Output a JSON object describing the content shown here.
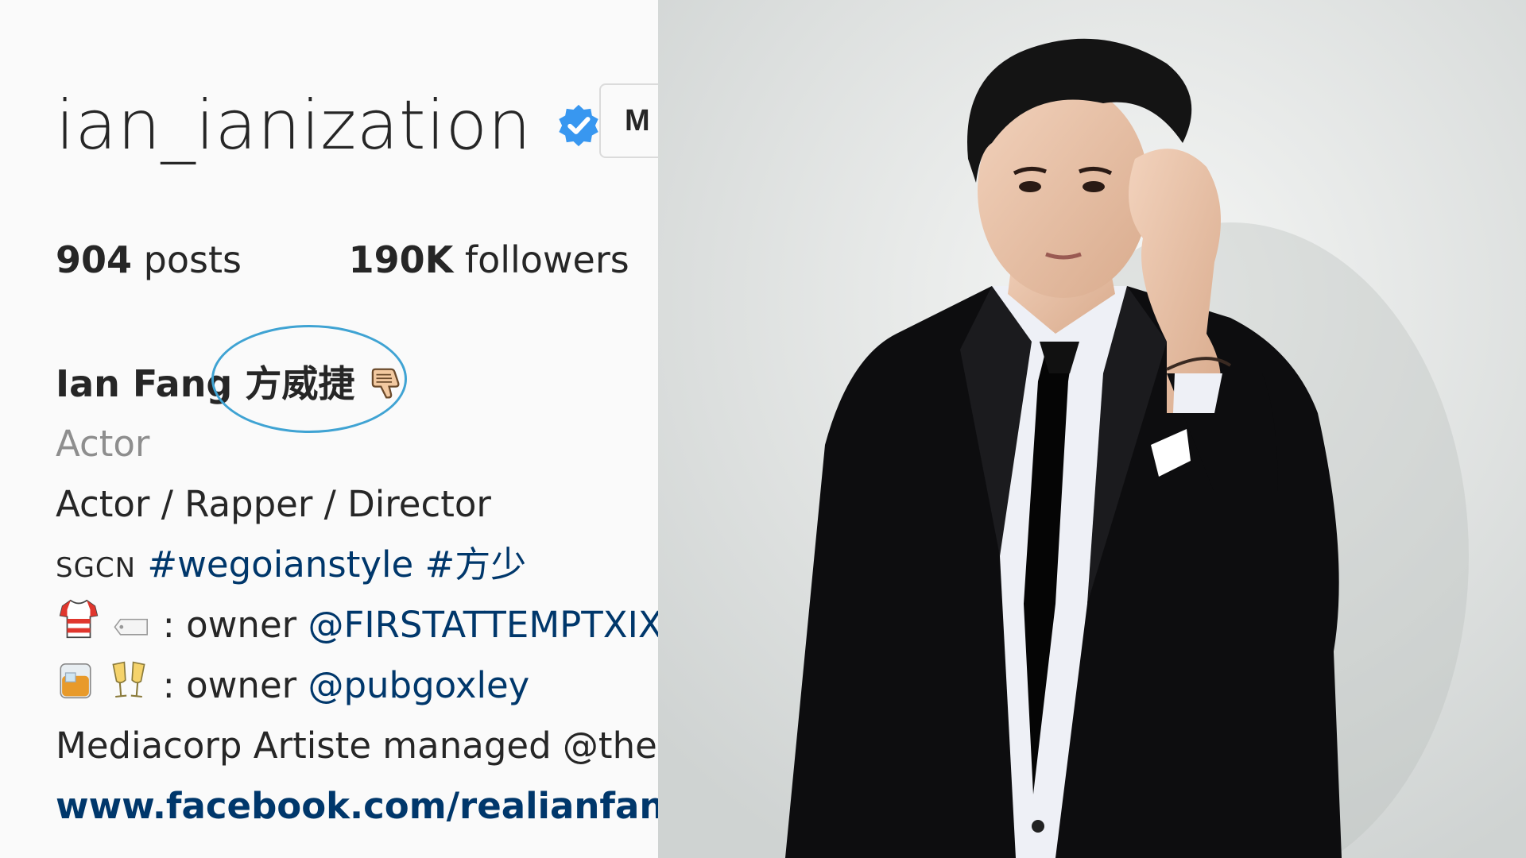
{
  "profile": {
    "username": "ian_ianization",
    "message_button": "M",
    "stats": {
      "posts_count": "904",
      "posts_label": "posts",
      "followers_count": "190K",
      "followers_label": "followers"
    },
    "full_name": "Ian Fang",
    "full_name_cn": "方威捷",
    "full_name_emoji": "👎",
    "category": "Actor",
    "bio": {
      "line1": "Actor / Rapper / Director",
      "line2_prefix": "SGCN",
      "line2_tags": "#wegoianstyle #方少",
      "line3_text": ": owner",
      "line3_mention": "@FIRSTATTEMPTXIX",
      "line4_text": ": owner",
      "line4_mention": "@pubgoxley",
      "line5": "Mediacorp Artiste managed @the",
      "link": "www.facebook.com/realianfang"
    }
  },
  "colors": {
    "verified_blue": "#3897f0",
    "link_blue": "#00376b",
    "circle_annotation": "#3fa3d3"
  },
  "icons": [
    "verified-badge-icon",
    "thumbs-down-emoji",
    "shirt-emoji",
    "tag-emoji",
    "whisky-glass-emoji",
    "clinking-glasses-emoji"
  ]
}
